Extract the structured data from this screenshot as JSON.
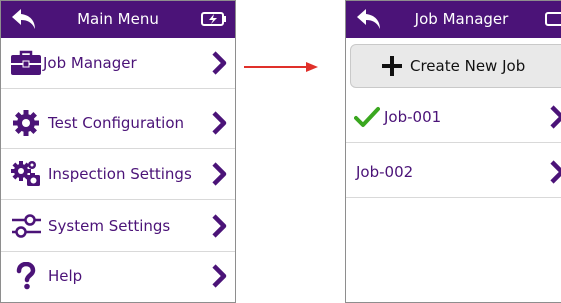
{
  "main_menu": {
    "title": "Main Menu",
    "items": [
      {
        "label": "Job Manager",
        "icon": "briefcase-icon"
      },
      {
        "label": "Test Configuration",
        "icon": "gear-icon"
      },
      {
        "label": "Inspection Settings",
        "icon": "gears-camera-icon"
      },
      {
        "label": "System Settings",
        "icon": "sliders-icon"
      },
      {
        "label": "Help",
        "icon": "question-mark-icon"
      }
    ]
  },
  "job_manager": {
    "title": "Job Manager",
    "create_label": "Create New Job",
    "jobs": [
      {
        "label": "Job-001",
        "status": "checked"
      },
      {
        "label": "Job-002",
        "status": "none"
      }
    ]
  },
  "colors": {
    "accent": "#4b1378",
    "arrow": "#e0302a",
    "check": "#3aa71f"
  }
}
